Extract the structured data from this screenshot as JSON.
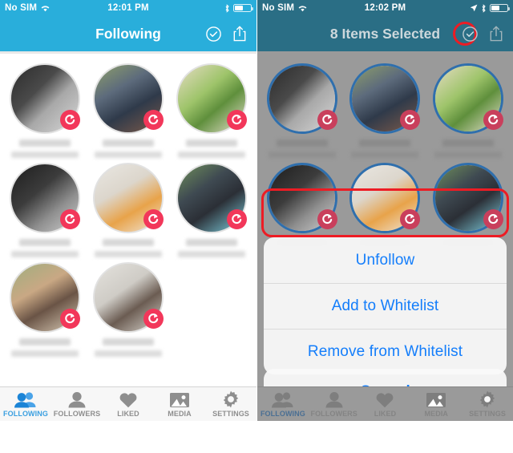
{
  "app": {
    "accent_cyan": "#29aedb",
    "accent_blue": "#147efb",
    "badge_pink": "#f2375a",
    "annotation_red": "#ed1c24",
    "selected_ring": "#2f6fad"
  },
  "left_panel": {
    "status_bar": {
      "carrier": "No SIM",
      "time": "12:01 PM",
      "wifi_icon": "wifi-icon",
      "bluetooth_icon": "bluetooth-icon",
      "battery_icon": "battery-icon",
      "battery_level": 52
    },
    "header": {
      "title": "Following",
      "select_icon": "check-circle-icon",
      "share_icon": "share-icon"
    },
    "users": [
      {
        "name_blurred": true,
        "subtitle_blurred": true,
        "selected": false,
        "badge_icon": "refresh-icon",
        "photo": "portrait-bw-man"
      },
      {
        "name_blurred": true,
        "subtitle_blurred": true,
        "selected": false,
        "badge_icon": "refresh-icon",
        "photo": "two-men-sunglasses"
      },
      {
        "name_blurred": true,
        "subtitle_blurred": true,
        "selected": false,
        "badge_icon": "refresh-icon",
        "photo": "green-plant"
      },
      {
        "name_blurred": true,
        "subtitle_blurred": true,
        "selected": false,
        "badge_icon": "refresh-icon",
        "photo": "woman-bw"
      },
      {
        "name_blurred": true,
        "subtitle_blurred": true,
        "selected": false,
        "badge_icon": "refresh-icon",
        "photo": "child-sunglasses"
      },
      {
        "name_blurred": true,
        "subtitle_blurred": true,
        "selected": false,
        "badge_icon": "refresh-icon",
        "photo": "young-man-jacket"
      },
      {
        "name_blurred": true,
        "subtitle_blurred": true,
        "selected": false,
        "badge_icon": "refresh-icon",
        "photo": "man-sunglasses-outdoor"
      },
      {
        "name_blurred": true,
        "subtitle_blurred": true,
        "selected": false,
        "badge_icon": "refresh-icon",
        "photo": "man-sunglasses-wall"
      }
    ],
    "tabs": [
      {
        "label": "FOLLOWING",
        "icon": "two-people-icon",
        "active": true
      },
      {
        "label": "FOLLOWERS",
        "icon": "person-icon",
        "active": false
      },
      {
        "label": "LIKED",
        "icon": "heart-icon",
        "active": false
      },
      {
        "label": "MEDIA",
        "icon": "photo-icon",
        "active": false
      },
      {
        "label": "SETTINGS",
        "icon": "gear-icon",
        "active": false
      }
    ]
  },
  "right_panel": {
    "status_bar": {
      "carrier": "No SIM",
      "time": "12:02 PM",
      "wifi_icon": "wifi-icon",
      "location_icon": "location-arrow-icon",
      "bluetooth_icon": "bluetooth-icon",
      "battery_icon": "battery-icon",
      "battery_level": 52
    },
    "header": {
      "title": "8 Items Selected",
      "select_icon": "check-circle-icon",
      "share_icon": "share-icon",
      "select_icon_highlighted": true
    },
    "users": [
      {
        "name_blurred": true,
        "subtitle_blurred": true,
        "selected": true,
        "badge_icon": "refresh-icon",
        "photo": "portrait-bw-man"
      },
      {
        "name_blurred": true,
        "subtitle_blurred": true,
        "selected": true,
        "badge_icon": "refresh-icon",
        "photo": "two-men-sunglasses"
      },
      {
        "name_blurred": true,
        "subtitle_blurred": true,
        "selected": true,
        "badge_icon": "refresh-icon",
        "photo": "green-plant"
      },
      {
        "name_blurred": true,
        "subtitle_blurred": true,
        "selected": true,
        "badge_icon": "refresh-icon",
        "photo": "woman-bw"
      },
      {
        "name_blurred": true,
        "subtitle_blurred": true,
        "selected": true,
        "badge_icon": "refresh-icon",
        "photo": "child-sunglasses"
      },
      {
        "name_blurred": true,
        "subtitle_blurred": true,
        "selected": true,
        "badge_icon": "refresh-icon",
        "photo": "young-man-jacket"
      }
    ],
    "action_sheet": {
      "options": [
        {
          "label": "Unfollow",
          "highlighted": true
        },
        {
          "label": "Add to Whitelist",
          "highlighted": false
        },
        {
          "label": "Remove from Whitelist",
          "highlighted": false
        }
      ],
      "cancel_label": "Cancel"
    },
    "tabs": [
      {
        "label": "FOLLOWING",
        "icon": "two-people-icon",
        "active": true
      },
      {
        "label": "FOLLOWERS",
        "icon": "person-icon",
        "active": false
      },
      {
        "label": "LIKED",
        "icon": "heart-icon",
        "active": false
      },
      {
        "label": "MEDIA",
        "icon": "photo-icon",
        "active": false
      },
      {
        "label": "SETTINGS",
        "icon": "gear-icon",
        "active": false
      }
    ]
  }
}
